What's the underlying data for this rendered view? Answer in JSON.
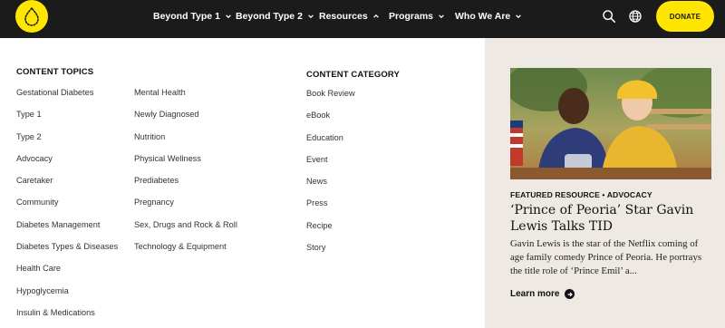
{
  "nav": {
    "items": [
      {
        "label": "Beyond Type 1",
        "expanded": false
      },
      {
        "label": "Beyond Type 2",
        "expanded": false
      },
      {
        "label": "Resources",
        "expanded": true
      },
      {
        "label": "Programs",
        "expanded": false
      },
      {
        "label": "Who We Are",
        "expanded": false
      }
    ],
    "search_icon": "search-icon",
    "language_icon": "globe-icon",
    "donate_label": "DONATE"
  },
  "colors": {
    "topbar": "#1b1b1b",
    "brand_yellow": "#ffe600",
    "feature_bg": "#efe9e4"
  },
  "menu": {
    "topics_title": "CONTENT TOPICS",
    "topics_col1": [
      "Gestational Diabetes",
      "Type 1",
      "Type 2",
      "Advocacy",
      "Caretaker",
      "Community",
      "Diabetes Management",
      "Diabetes Types & Diseases",
      "Health Care",
      "Hypoglycemia",
      "Insulin & Medications"
    ],
    "topics_col2": [
      "Mental Health",
      "Newly Diagnosed",
      "Nutrition",
      "Physical Wellness",
      "Prediabetes",
      "Pregnancy",
      "Sex, Drugs and Rock & Roll",
      "Technology & Equipment"
    ],
    "category_title": "CONTENT CATEGORY",
    "categories": [
      "Book Review",
      "eBook",
      "Education",
      "Event",
      "News",
      "Press",
      "Recipe",
      "Story"
    ]
  },
  "featured": {
    "tag": "FEATURED RESOURCE • ADVOCACY",
    "headline": "‘Prince of Peoria’ Star Gavin Lewis Talks TID",
    "description": "Gavin Lewis is the star of the Netflix coming of age family comedy Prince of Peoria. He portrays the title role of ‘Prince Emil’ a...",
    "cta": "Learn more"
  }
}
